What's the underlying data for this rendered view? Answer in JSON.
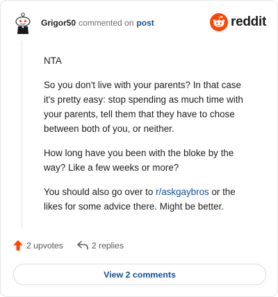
{
  "header": {
    "username": "Grigor50",
    "action": "commented on",
    "link": "post",
    "brand": "reddit"
  },
  "comment": {
    "paragraphs": {
      "p1": "NTA",
      "p2": "So you don't live with your parents? In that case it's pretty easy: stop spending as much time with your parents, tell them that they have to chose between both of you, or neither.",
      "p3": "How long have you been with the bloke by the way? Like a few weeks or more?",
      "p4_before": "You should also go over to ",
      "p4_link": "r/askgaybros",
      "p4_after": " or the likes for some advice there. Might be better."
    }
  },
  "actions": {
    "upvotes": "2 upvotes",
    "replies": "2 replies"
  },
  "footer": {
    "view_comments": "View 2 comments"
  },
  "colors": {
    "brand_orange": "#ff4500",
    "link_blue": "#0f4f93"
  }
}
